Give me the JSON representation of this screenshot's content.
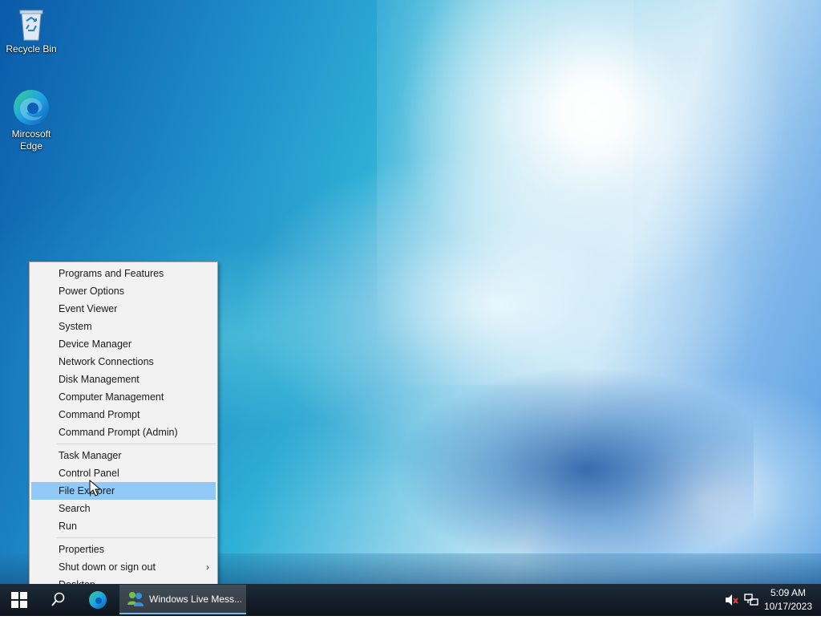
{
  "desktop": {
    "icons": [
      {
        "label": "Recycle Bin",
        "icon": "recycle-bin-icon"
      },
      {
        "label_line1": "Mircosoft",
        "label_line2": "Edge",
        "icon": "edge-icon"
      }
    ]
  },
  "context_menu": {
    "group1": [
      "Programs and Features",
      "Power Options",
      "Event Viewer",
      "System",
      "Device Manager",
      "Network Connections",
      "Disk Management",
      "Computer Management",
      "Command Prompt",
      "Command Prompt (Admin)"
    ],
    "group2": [
      "Task Manager",
      "Control Panel",
      "File Explorer",
      "Search",
      "Run"
    ],
    "group3": [
      "Properties",
      "Shut down or sign out",
      "Desktop"
    ],
    "highlighted_item": "File Explorer",
    "highlight_color": "#91c9f7"
  },
  "taskbar": {
    "start_icon": "windows-logo-icon",
    "search_icon": "search-icon",
    "pinned_icon": "edge-icon",
    "running_app": {
      "label": "Windows Live Mess...",
      "icon": "messenger-icon"
    },
    "tray": {
      "volume_icon": "volume-muted-icon",
      "network_icon": "network-icon"
    },
    "clock": {
      "time": "5:09 AM",
      "date": "10/17/2023"
    }
  }
}
